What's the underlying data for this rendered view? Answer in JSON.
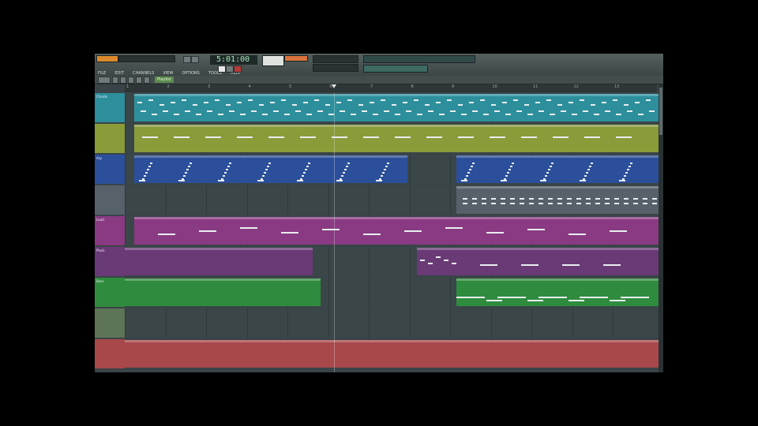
{
  "toolbar": {
    "time": "5:01:00",
    "menus": [
      "FILE",
      "EDIT",
      "CHANNELS",
      "VIEW",
      "OPTIONS",
      "TOOLS",
      "HELP"
    ],
    "playlist_label": "Playlist"
  },
  "ruler": {
    "bars": [
      "1",
      "2",
      "3",
      "4",
      "5",
      "6",
      "7",
      "8",
      "9",
      "10",
      "11",
      "12",
      "13"
    ]
  },
  "colors": {
    "teal": "#2d8f9c",
    "olive": "#8a9b3a",
    "blue": "#2b4f9a",
    "slate": "#56616a",
    "magenta": "#8a3a82",
    "purple": "#6a3a76",
    "green": "#2f8c3e",
    "sage": "#5e7456",
    "red": "#a8484a"
  },
  "tracks": [
    {
      "name": "Chords",
      "color": "teal"
    },
    {
      "name": "",
      "color": "olive"
    },
    {
      "name": "Arp",
      "color": "blue"
    },
    {
      "name": "",
      "color": "slate"
    },
    {
      "name": "Lead",
      "color": "magenta"
    },
    {
      "name": "Pluck",
      "color": "purple"
    },
    {
      "name": "Bass",
      "color": "green"
    },
    {
      "name": "",
      "color": "sage"
    },
    {
      "name": "",
      "color": "red"
    }
  ]
}
